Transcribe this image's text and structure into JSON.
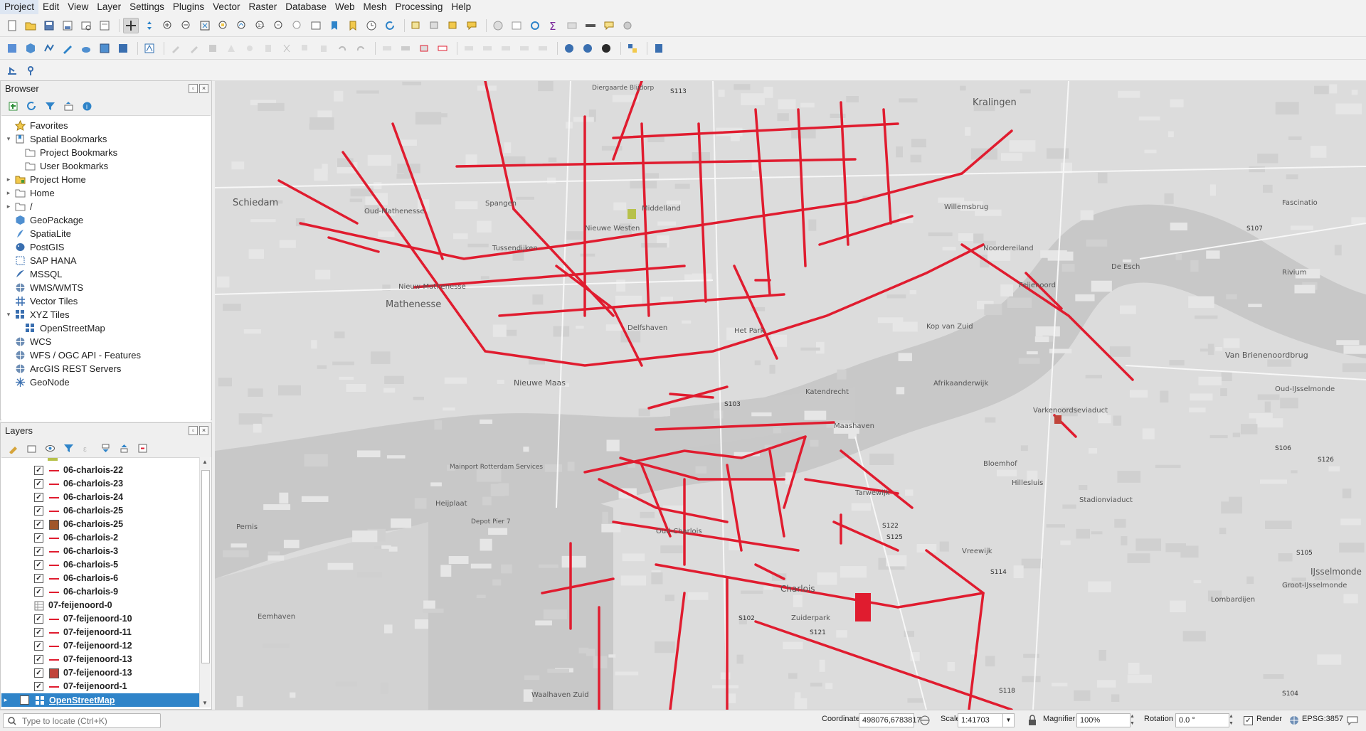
{
  "menu": [
    "Project",
    "Edit",
    "View",
    "Layer",
    "Settings",
    "Plugins",
    "Vector",
    "Raster",
    "Database",
    "Web",
    "Mesh",
    "Processing",
    "Help"
  ],
  "browser": {
    "title": "Browser",
    "items": [
      {
        "label": "Favorites",
        "indent": 0,
        "arrow": "",
        "icon": "star-icon"
      },
      {
        "label": "Spatial Bookmarks",
        "indent": 0,
        "arrow": "▾",
        "icon": "bookmark-icon"
      },
      {
        "label": "Project Bookmarks",
        "indent": 1,
        "arrow": "",
        "icon": "folder-icon"
      },
      {
        "label": "User Bookmarks",
        "indent": 1,
        "arrow": "",
        "icon": "folder-icon"
      },
      {
        "label": "Project Home",
        "indent": 0,
        "arrow": "▸",
        "icon": "project-home-icon"
      },
      {
        "label": "Home",
        "indent": 0,
        "arrow": "▸",
        "icon": "home-folder-icon"
      },
      {
        "label": "/",
        "indent": 0,
        "arrow": "▸",
        "icon": "root-folder-icon"
      },
      {
        "label": "GeoPackage",
        "indent": 0,
        "arrow": "",
        "icon": "geopackage-icon"
      },
      {
        "label": "SpatiaLite",
        "indent": 0,
        "arrow": "",
        "icon": "spatialite-icon"
      },
      {
        "label": "PostGIS",
        "indent": 0,
        "arrow": "",
        "icon": "postgis-icon"
      },
      {
        "label": "SAP HANA",
        "indent": 0,
        "arrow": "",
        "icon": "sap-hana-icon"
      },
      {
        "label": "MSSQL",
        "indent": 0,
        "arrow": "",
        "icon": "mssql-icon"
      },
      {
        "label": "WMS/WMTS",
        "indent": 0,
        "arrow": "",
        "icon": "globe-icon"
      },
      {
        "label": "Vector Tiles",
        "indent": 0,
        "arrow": "",
        "icon": "vector-tiles-icon"
      },
      {
        "label": "XYZ Tiles",
        "indent": 0,
        "arrow": "▾",
        "icon": "xyz-tiles-icon"
      },
      {
        "label": "OpenStreetMap",
        "indent": 1,
        "arrow": "",
        "icon": "xyz-tiles-icon"
      },
      {
        "label": "WCS",
        "indent": 0,
        "arrow": "",
        "icon": "globe-icon"
      },
      {
        "label": "WFS / OGC API - Features",
        "indent": 0,
        "arrow": "",
        "icon": "globe-icon"
      },
      {
        "label": "ArcGIS REST Servers",
        "indent": 0,
        "arrow": "",
        "icon": "globe-icon"
      },
      {
        "label": "GeoNode",
        "indent": 0,
        "arrow": "",
        "icon": "geonode-icon"
      }
    ]
  },
  "layers": {
    "title": "Layers",
    "items": [
      {
        "label": "06-charlois-22",
        "sym": "line",
        "checked": true
      },
      {
        "label": "06-charlois-23",
        "sym": "line",
        "checked": true
      },
      {
        "label": "06-charlois-24",
        "sym": "line",
        "checked": true
      },
      {
        "label": "06-charlois-25",
        "sym": "line",
        "checked": true
      },
      {
        "label": "06-charlois-25",
        "sym": "fill-brown",
        "checked": true
      },
      {
        "label": "06-charlois-2",
        "sym": "line",
        "checked": true
      },
      {
        "label": "06-charlois-3",
        "sym": "line",
        "checked": true
      },
      {
        "label": "06-charlois-5",
        "sym": "line",
        "checked": true
      },
      {
        "label": "06-charlois-6",
        "sym": "line",
        "checked": true
      },
      {
        "label": "06-charlois-9",
        "sym": "line",
        "checked": true
      },
      {
        "label": "07-feijenoord-0",
        "sym": "table",
        "checked": false
      },
      {
        "label": "07-feijenoord-10",
        "sym": "line",
        "checked": true
      },
      {
        "label": "07-feijenoord-11",
        "sym": "line",
        "checked": true
      },
      {
        "label": "07-feijenoord-12",
        "sym": "line",
        "checked": true
      },
      {
        "label": "07-feijenoord-13",
        "sym": "line",
        "checked": true
      },
      {
        "label": "07-feijenoord-13",
        "sym": "fill-red",
        "checked": true
      },
      {
        "label": "07-feijenoord-1",
        "sym": "line",
        "checked": true
      }
    ],
    "selected": {
      "label": "OpenStreetMap"
    }
  },
  "map": {
    "labels": [
      {
        "t": "Schiedam"
      },
      {
        "t": "Mathenesse"
      },
      {
        "t": "Nieuw-Mathenesse"
      },
      {
        "t": "Oud-Mathenesse"
      },
      {
        "t": "Spangen"
      },
      {
        "t": "Nieuwe Westen"
      },
      {
        "t": "Middelland"
      },
      {
        "t": "Tussendijken"
      },
      {
        "t": "Delfshaven"
      },
      {
        "t": "Het Park"
      },
      {
        "t": "Kralingen"
      },
      {
        "t": "Willemsbrug"
      },
      {
        "t": "Noordereiland"
      },
      {
        "t": "Kop van Zuid"
      },
      {
        "t": "Feijenoord"
      },
      {
        "t": "Katendrecht"
      },
      {
        "t": "Afrikaanderwijk"
      },
      {
        "t": "Maashaven"
      },
      {
        "t": "Nieuwe Maas"
      },
      {
        "t": "Bloemhof"
      },
      {
        "t": "Hillesluis"
      },
      {
        "t": "Varkenoordseviaduct"
      },
      {
        "t": "Stadionviaduct"
      },
      {
        "t": "Tarwewijk"
      },
      {
        "t": "Oud-Charlois"
      },
      {
        "t": "Charlois"
      },
      {
        "t": "Zuiderpark"
      },
      {
        "t": "Vreewijk"
      },
      {
        "t": "Heijplaat"
      },
      {
        "t": "De Esch"
      },
      {
        "t": "Fascinatio"
      },
      {
        "t": "Rivium"
      },
      {
        "t": "Van Brienenoordbrug"
      },
      {
        "t": "Oud-IJsselmonde"
      },
      {
        "t": "IJsselmonde"
      },
      {
        "t": "Groot-IJsselmonde"
      },
      {
        "t": "Waalhaven Zuid"
      },
      {
        "t": "Eemhaven"
      },
      {
        "t": "Pernis"
      },
      {
        "t": "Mainport Rotterdam Services"
      },
      {
        "t": "Depot Pier 7"
      },
      {
        "t": "Lombardijen"
      },
      {
        "t": "Diergaarde Blijdorp"
      },
      {
        "t": "S113"
      },
      {
        "t": "S103"
      },
      {
        "t": "S102"
      },
      {
        "t": "S106"
      },
      {
        "t": "S126"
      },
      {
        "t": "S105"
      },
      {
        "t": "S107"
      },
      {
        "t": "S104"
      },
      {
        "t": "S114"
      },
      {
        "t": "S121"
      },
      {
        "t": "S125"
      },
      {
        "t": "S122"
      },
      {
        "t": "S118"
      }
    ]
  },
  "status": {
    "search_placeholder": "Type to locate (Ctrl+K)",
    "coordinate_label": "Coordinate",
    "coordinate": "498076,6783817",
    "scale_label": "Scale",
    "scale": "1:41703",
    "magnifier_label": "Magnifier",
    "magnifier": "100%",
    "rotation_label": "Rotation",
    "rotation": "0.0 °",
    "render_label": "Render",
    "crs": "EPSG:3857"
  },
  "colors": {
    "accent": "#2f84c9",
    "route": "#e01c2f",
    "map_bg": "#dcdcdc",
    "water": "#c8c8c8"
  }
}
